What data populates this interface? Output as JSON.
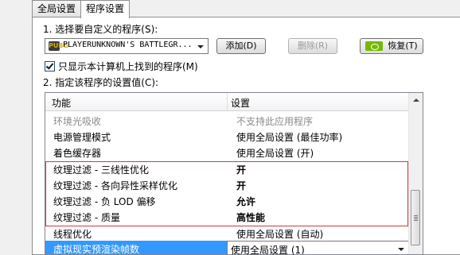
{
  "tabs": [
    {
      "label": "全局设置"
    },
    {
      "label": "程序设置"
    }
  ],
  "step1": {
    "label": "1. 选择要自定义的程序(S):"
  },
  "program_select": {
    "icon_text": "PUBG",
    "value": "PLAYERUNKNOWN'S BATTLEGR..."
  },
  "buttons": {
    "add": "添加(D)",
    "remove": "删除(R)",
    "restore": "恢复(T)"
  },
  "checkbox": {
    "label": "只显示本计算机上找到的程序(M)",
    "checked": true
  },
  "step2": {
    "label": "2. 指定该程序的设置值(C):"
  },
  "grid": {
    "header": {
      "feature": "功能",
      "setting": "设置"
    },
    "rows": [
      {
        "feature": "环境光吸收",
        "setting": "不支持此应用程序"
      },
      {
        "feature": "电源管理模式",
        "setting": "使用全局设置 (最佳功率)"
      },
      {
        "feature": "着色缓存器",
        "setting": "使用全局设置 (开)"
      },
      {
        "feature": "纹理过滤 - 三线性优化",
        "setting": "开"
      },
      {
        "feature": "纹理过滤 - 各向异性采样优化",
        "setting": "开"
      },
      {
        "feature": "纹理过滤 - 负 LOD 偏移",
        "setting": "允许"
      },
      {
        "feature": "纹理过滤 - 质量",
        "setting": "高性能"
      },
      {
        "feature": "线程优化",
        "setting": "使用全局设置 (自动)"
      },
      {
        "feature": "虚拟现实预渲染帧数",
        "setting": "使用全局设置 (1)"
      }
    ]
  },
  "colors": {
    "highlight_border": "#d23a3a",
    "selection": "#3399ff",
    "nvidia": "#76b900"
  }
}
